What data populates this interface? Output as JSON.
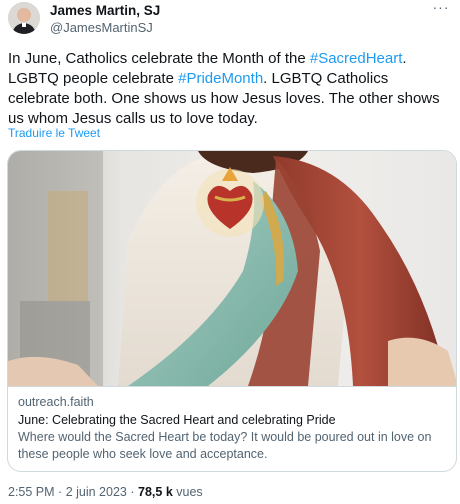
{
  "author": {
    "display_name": "James Martin, SJ",
    "handle": "@JamesMartinSJ"
  },
  "more_label": "···",
  "tweet": {
    "parts": [
      {
        "text": "In June, Catholics celebrate the Month of the ",
        "type": "text"
      },
      {
        "text": "#SacredHeart",
        "type": "hashtag"
      },
      {
        "text": ". LGBTQ people celebrate ",
        "type": "text"
      },
      {
        "text": "#PrideMonth",
        "type": "hashtag"
      },
      {
        "text": ". LGBTQ Catholics celebrate both. One shows us how Jesus loves. The other shows us whom Jesus calls us to love today.",
        "type": "text"
      }
    ],
    "translate_label": "Traduire le Tweet"
  },
  "card": {
    "domain": "outreach.faith",
    "title": "June: Celebrating the Sacred Heart and celebrating Pride",
    "description": "Where would the Sacred Heart be today?  It would be poured out in love on these people who seek love and acceptance."
  },
  "meta": {
    "time": "2:55 PM",
    "separator": "·",
    "date": "2 juin 2023",
    "views_count": "78,5 k",
    "views_label": "vues"
  },
  "colors": {
    "accent": "#1d9bf0",
    "secondary_text": "#536471",
    "border": "#cfd9de"
  }
}
